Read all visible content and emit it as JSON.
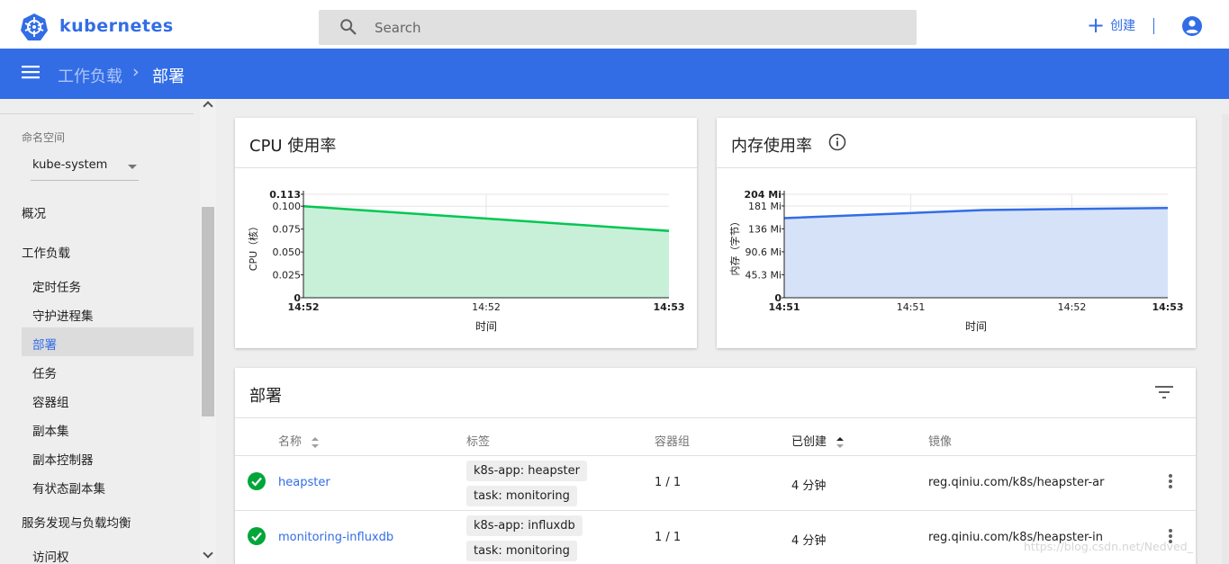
{
  "app": {
    "brand": "kubernetes"
  },
  "search": {
    "placeholder": "Search"
  },
  "top_actions": {
    "create_label": "创建"
  },
  "breadcrumb": {
    "parent": "工作负载",
    "separator": "›",
    "current": "部署"
  },
  "sidebar": {
    "namespace_label": "命名空间",
    "namespace_value": "kube-system",
    "overview": "概况",
    "workloads": "工作负载",
    "items": [
      {
        "label": "定时任务"
      },
      {
        "label": "守护进程集"
      },
      {
        "label": "部署",
        "active": true
      },
      {
        "label": "任务"
      },
      {
        "label": "容器组"
      },
      {
        "label": "副本集"
      },
      {
        "label": "副本控制器"
      },
      {
        "label": "有状态副本集"
      }
    ],
    "discovery": "服务发现与负载均衡",
    "access": "访问权"
  },
  "colors": {
    "accent": "#326de6",
    "cpu_line": "#00c752",
    "cpu_fill": "#c8f0d9",
    "mem_line": "#326de6",
    "mem_fill": "#d6e2f8",
    "ok": "#00a63a"
  },
  "cpu_card": {
    "title": "CPU 使用率"
  },
  "mem_card": {
    "title": "内存使用率"
  },
  "chart_data": [
    {
      "type": "area",
      "title": "CPU 使用率",
      "xlabel": "时间",
      "ylabel": "CPU（核）",
      "x_ticks": [
        "14:52",
        "14:52",
        "14:53"
      ],
      "y_ticks": [
        "0",
        "0.025",
        "0.050",
        "0.075",
        "0.100",
        "0.113"
      ],
      "ylim": [
        0,
        0.113
      ],
      "x": [
        0,
        1
      ],
      "values": [
        0.1,
        0.073
      ]
    },
    {
      "type": "area",
      "title": "内存使用率",
      "xlabel": "时间",
      "ylabel": "内存（字节）",
      "x_ticks": [
        "14:51",
        "14:51",
        "14:52",
        "14:53"
      ],
      "y_ticks": [
        "0",
        "45.3 Mi",
        "90.6 Mi",
        "136 Mi",
        "181 Mi",
        "204 Mi"
      ],
      "ylim": [
        0,
        204
      ],
      "x": [
        0,
        0.33,
        0.52,
        0.73,
        1
      ],
      "values": [
        157,
        167,
        173,
        175,
        177
      ]
    }
  ],
  "deployments": {
    "title": "部署",
    "headers": {
      "name": "名称",
      "labels": "标签",
      "pods": "容器组",
      "created": "已创建",
      "images": "镜像"
    },
    "rows": [
      {
        "name": "heapster",
        "labels": [
          "k8s-app: heapster",
          "task: monitoring"
        ],
        "pods": "1 / 1",
        "created": "4 分钟",
        "image": "reg.qiniu.com/k8s/heapster-ar"
      },
      {
        "name": "monitoring-influxdb",
        "labels": [
          "k8s-app: influxdb",
          "task: monitoring"
        ],
        "pods": "1 / 1",
        "created": "4 分钟",
        "image": "reg.qiniu.com/k8s/heapster-in"
      }
    ]
  },
  "watermark": "https://blog.csdn.net/Nedved_"
}
